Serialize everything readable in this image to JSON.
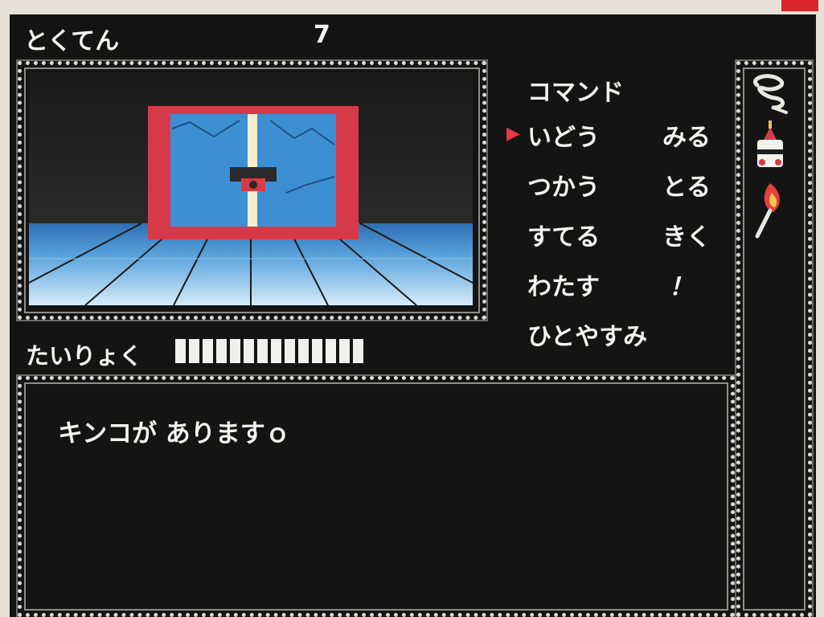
{
  "header": {
    "score_label": "とくてん",
    "score_value": "7"
  },
  "stamina": {
    "label": "たいりょく",
    "level": 14,
    "max": 14
  },
  "commands": {
    "title": "コマンド",
    "selected": "いどう",
    "items": [
      {
        "label": "いどう"
      },
      {
        "label": "みる"
      },
      {
        "label": "つかう"
      },
      {
        "label": "とる"
      },
      {
        "label": "すてる"
      },
      {
        "label": "きく"
      },
      {
        "label": "わたす"
      },
      {
        "label": "！"
      },
      {
        "label": "ひとやすみ"
      }
    ]
  },
  "message": {
    "text": "キンコが ありますｏ"
  },
  "inventory": {
    "items": [
      "rope-icon",
      "cake-icon",
      "torch-icon"
    ]
  },
  "colors": {
    "wall_red": "#d63a48",
    "safe_blue": "#3d8fd4",
    "floor_light": "#cfe6f5",
    "background": "#141414",
    "cursor": "#e8384a"
  }
}
